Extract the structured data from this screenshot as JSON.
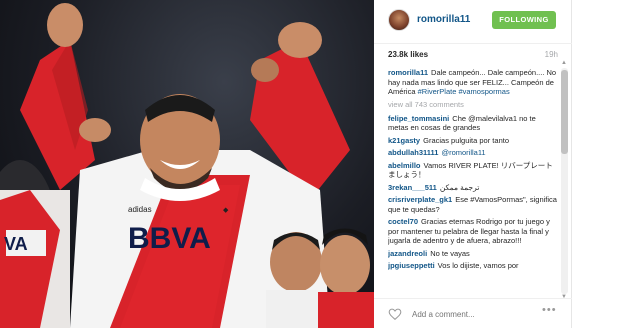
{
  "post": {
    "username": "romorilla11",
    "follow_label": "FOLLOWING",
    "likes": "23.8k likes",
    "time": "19h",
    "view_all": "view all 743 comments",
    "comment_placeholder": "Add a comment...",
    "jersey_text": "BBVA"
  },
  "comments": [
    {
      "user": "romorilla11",
      "text": "Dale campeón... Dale campeón.... No hay nada mas lindo que ser FELIZ... Campeón de América",
      "tags": "#RiverPlate #vamospormas"
    },
    {
      "user": "felipe_tommasini",
      "text": "Che @malevilalva1 no te metas en cosas de grandes"
    },
    {
      "user": "k21gasty",
      "text": "Gracias pulguita por tanto"
    },
    {
      "user": "abdullah31111",
      "text": "@romorilla11"
    },
    {
      "user": "abelmillo",
      "text": "Vamos RIVER PLATE! リバープレートましょう！"
    },
    {
      "user": "3rekan___511",
      "text": "ترجمة ممكن"
    },
    {
      "user": "crisriverplate_gk1",
      "text": "Ese #VamosPormas\", significa que te quedas?"
    },
    {
      "user": "coctel70",
      "text": "Gracias eternas Rodrigo por tu juego y por mantener tu pelabra de llegar hasta la final y jugarla de adentro y de afuera, abrazo!!!"
    },
    {
      "user": "jazandreoli",
      "text": "No te vayas"
    },
    {
      "user": "jpgiuseppetti",
      "text": "Vos lo dijiste, vamos por"
    }
  ],
  "colors": {
    "link": "#125688",
    "follow": "#70c050",
    "jersey_red": "#d8232a"
  }
}
